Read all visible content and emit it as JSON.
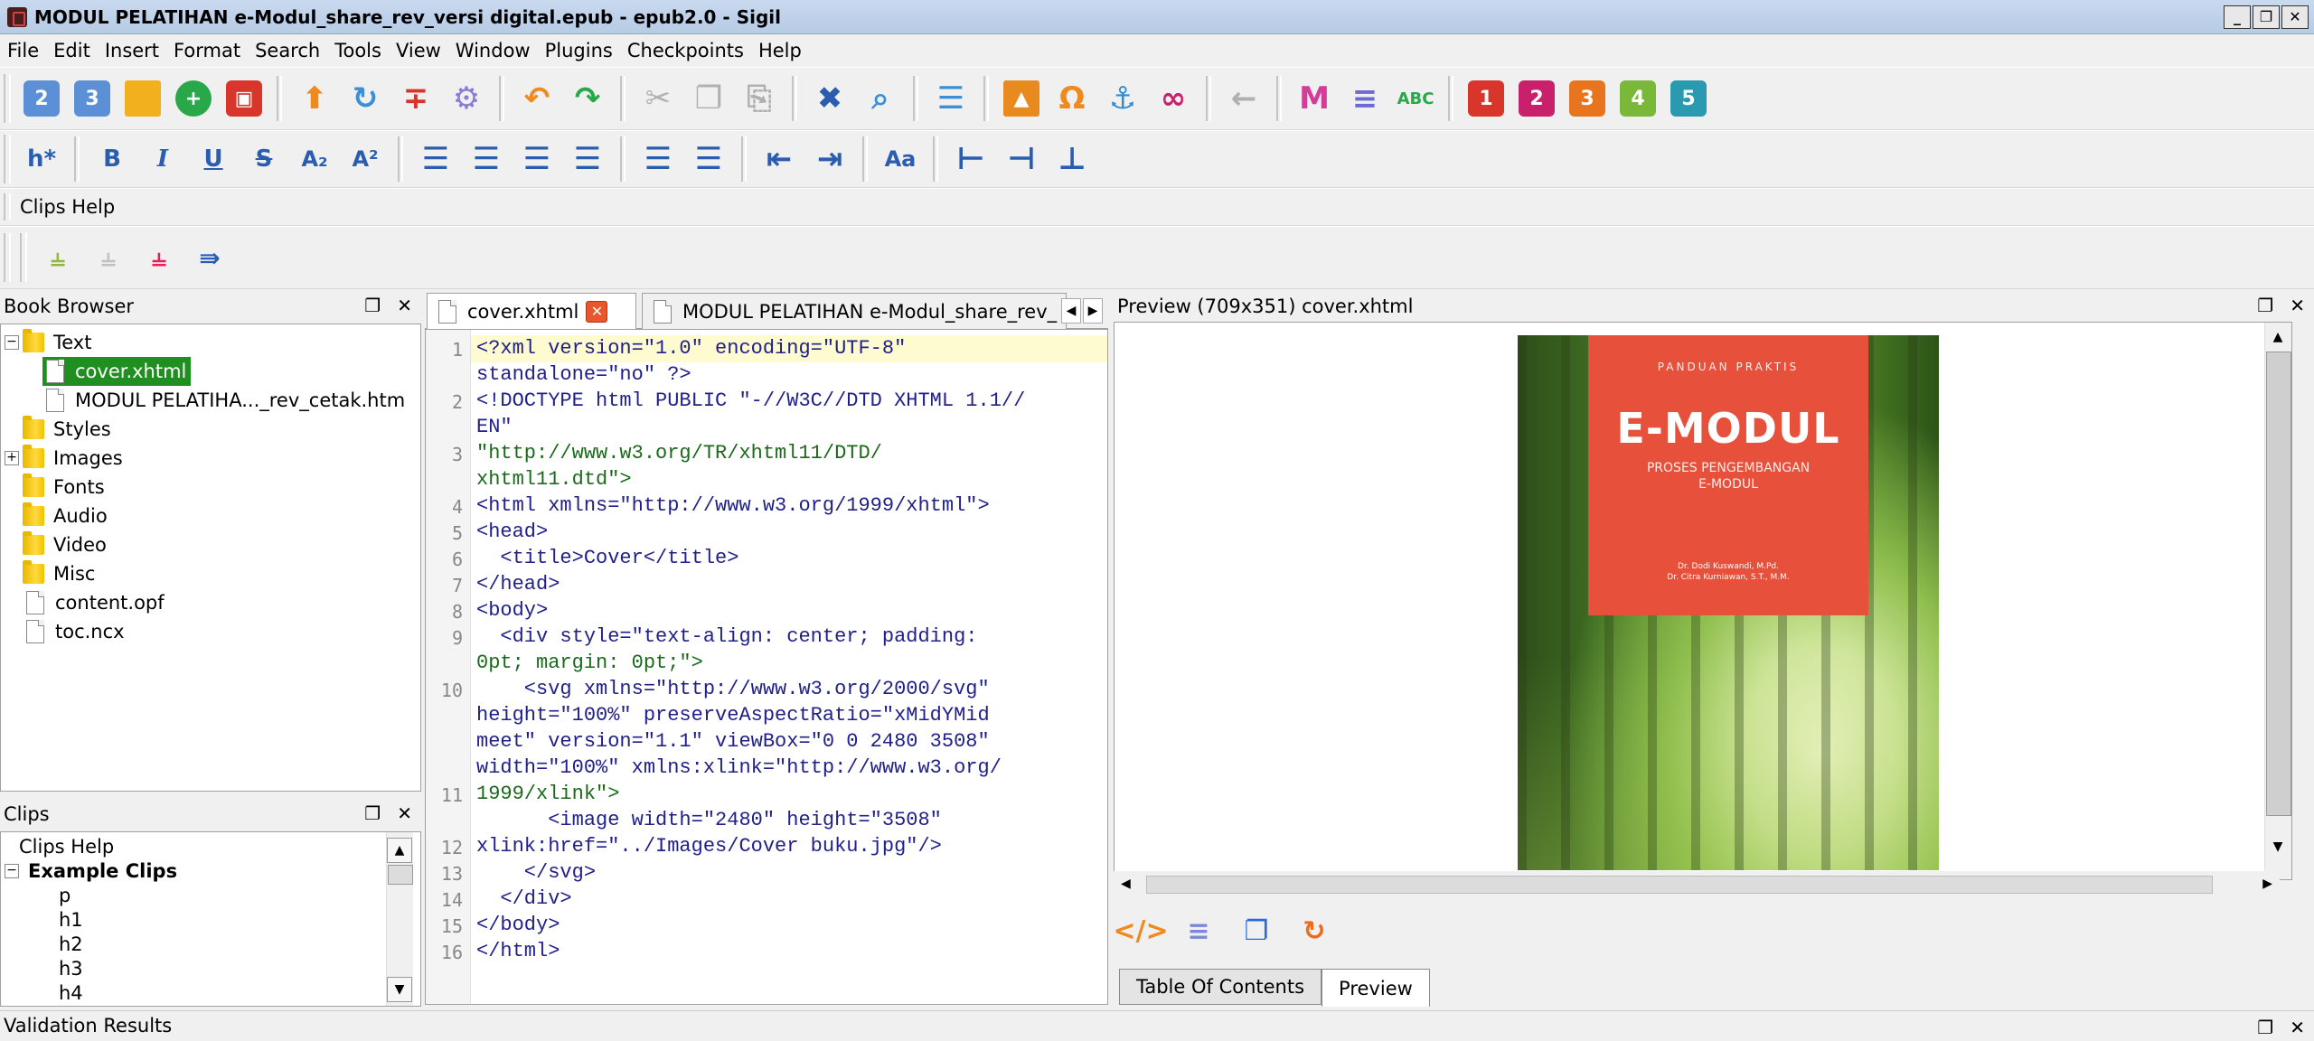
{
  "window": {
    "title": "MODUL PELATIHAN e-Modul_share_rev_versi digital.epub - epub2.0 - Sigil",
    "controls": [
      "_",
      "ȃ",
      "✕"
    ]
  },
  "menu": [
    "File",
    "Edit",
    "Insert",
    "Format",
    "Search",
    "Tools",
    "View",
    "Window",
    "Plugins",
    "Checkpoints",
    "Help"
  ],
  "toolbar_main": {
    "icons": [
      "new-book-2-icon",
      "new-book-3-icon",
      "open-folder-icon",
      "add-file-icon",
      "save-icon",
      "upload-arrow-icon",
      "reload-icon",
      "split-icon",
      "settings-icon",
      "undo-icon",
      "redo-icon",
      "cut-icon",
      "copy-icon",
      "paste-icon",
      "validate-icon",
      "search-icon",
      "toc-icon",
      "image-icon",
      "omega-icon",
      "anchor-icon",
      "link-icon",
      "back-arrow-icon",
      "metadata-icon",
      "list-icon",
      "spellcheck-icon",
      "plugin-1-icon",
      "plugin-2-icon",
      "plugin-3-icon",
      "plugin-4-icon",
      "plugin-5-icon"
    ],
    "book_2_label": "2",
    "book_3_label": "3",
    "plugin_labels": [
      "1",
      "2",
      "3",
      "4",
      "5"
    ],
    "spellcheck_label": "ABC"
  },
  "toolbar_format": {
    "heading_label": "h*",
    "bold": "B",
    "italic": "I",
    "underline": "U",
    "strike": "S",
    "subscript": "A₂",
    "superscript": "A²",
    "case_label": "Aa"
  },
  "clips_toolbar": {
    "label": "Clips Help"
  },
  "book_browser": {
    "title": "Book Browser",
    "items": [
      {
        "label": "Text",
        "type": "folder",
        "expander": "−"
      },
      {
        "label": "cover.xhtml",
        "type": "file",
        "selected": true
      },
      {
        "label": "MODUL PELATIHA..._rev_cetak.htm",
        "type": "file"
      },
      {
        "label": "Styles",
        "type": "folder"
      },
      {
        "label": "Images",
        "type": "folder",
        "expander": "+"
      },
      {
        "label": "Fonts",
        "type": "folder"
      },
      {
        "label": "Audio",
        "type": "folder"
      },
      {
        "label": "Video",
        "type": "folder"
      },
      {
        "label": "Misc",
        "type": "folder"
      },
      {
        "label": "content.opf",
        "type": "file"
      },
      {
        "label": "toc.ncx",
        "type": "file"
      }
    ]
  },
  "clips": {
    "title": "Clips",
    "items": [
      "Clips Help",
      "Example Clips",
      "p",
      "h1",
      "h2",
      "h3",
      "h4"
    ]
  },
  "editor": {
    "tabs": [
      {
        "label": "cover.xhtml",
        "active": true
      },
      {
        "label": "MODUL PELATIHAN e-Modul_share_rev_",
        "active": false
      }
    ],
    "line_numbers": [
      "1",
      "2",
      "3",
      "4",
      "5",
      "6",
      "7",
      "8",
      "9",
      "10",
      "11",
      "12",
      "13",
      "14",
      "15",
      "16"
    ],
    "lines": [
      "<?xml version=\"1.0\" encoding=\"UTF-8\"",
      "standalone=\"no\" ?>",
      "<!DOCTYPE html PUBLIC \"-//W3C//DTD XHTML 1.1//",
      "EN\"",
      "\"http://www.w3.org/TR/xhtml11/DTD/",
      "xhtml11.dtd\">",
      "<html xmlns=\"http://www.w3.org/1999/xhtml\">",
      "<head>",
      "  <title>Cover</title>",
      "</head>",
      "<body>",
      "  <div style=\"text-align: center; padding:",
      "0pt; margin: 0pt;\">",
      "    <svg xmlns=\"http://www.w3.org/2000/svg\"",
      "height=\"100%\" preserveAspectRatio=\"xMidYMid",
      "meet\" version=\"1.1\" viewBox=\"0 0 2480 3508\"",
      "width=\"100%\" xmlns:xlink=\"http://www.w3.org/",
      "1999/xlink\">",
      "      <image width=\"2480\" height=\"3508\"",
      "xlink:href=\"../Images/Cover buku.jpg\"/>",
      "    </svg>",
      "  </div>",
      "</body>",
      "</html>"
    ]
  },
  "preview": {
    "title": "Preview (709x351) cover.xhtml",
    "cover": {
      "small_text": "PANDUAN PRAKTIS",
      "title": "E-MODUL",
      "subtitle_1": "PROSES PENGEMBANGAN",
      "subtitle_2": "E-MODUL",
      "author_1": "Dr. Dodi Kuswandi, M.Pd.",
      "author_2": "Dr. Citra Kurniawan, S.T., M.M."
    }
  },
  "bottom_tabs": [
    "Table Of Contents",
    "Preview"
  ],
  "validation": {
    "title": "Validation Results"
  },
  "dock_buttons": {
    "float": "❐",
    "close": "✕"
  },
  "colors": {
    "selection": "#1f8f1f",
    "cover_red": "#e7503a",
    "titlebar": "#c9d9ee"
  }
}
